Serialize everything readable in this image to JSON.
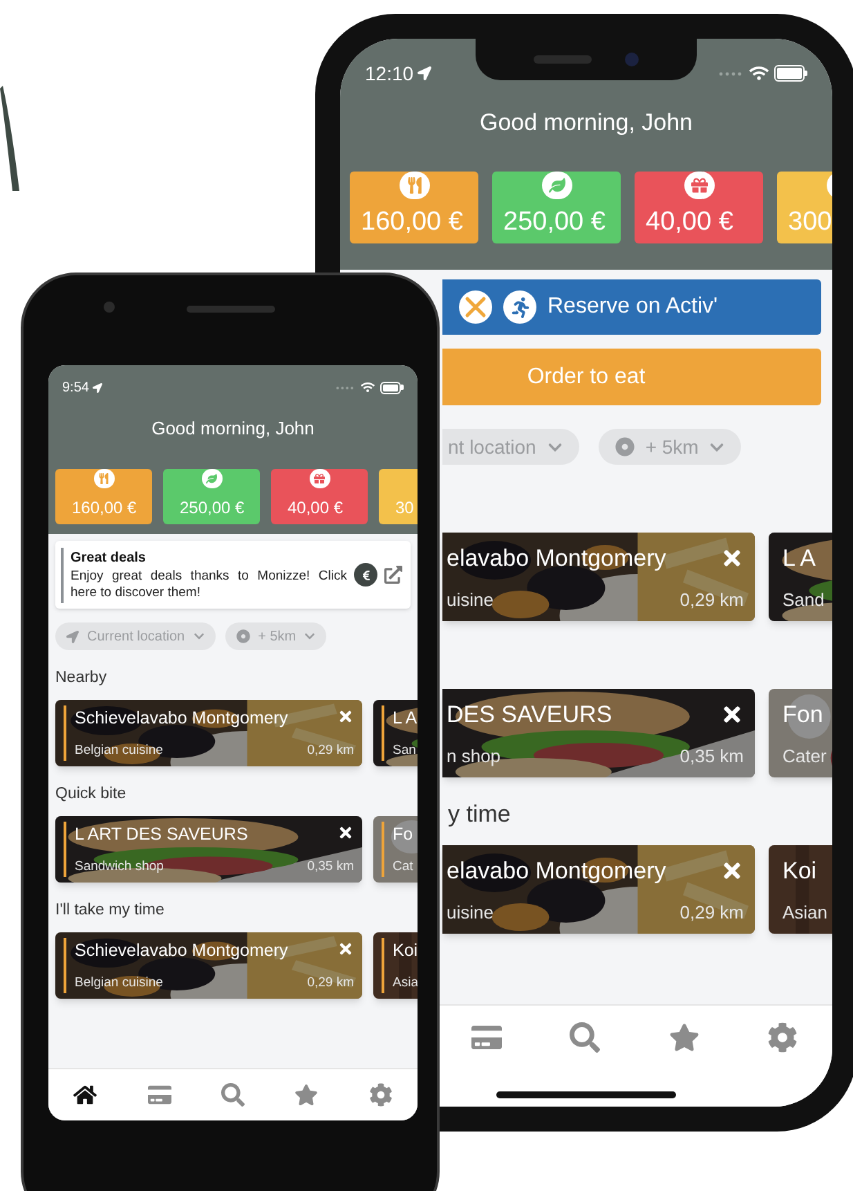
{
  "back_phone": {
    "status_time": "12:10",
    "greeting": "Good morning, John",
    "wallets": [
      {
        "kind": "meal",
        "amount": "160,00 €",
        "color": "#eea43a"
      },
      {
        "kind": "eco",
        "amount": "250,00 €",
        "color": "#5bc96b"
      },
      {
        "kind": "gift",
        "amount": "40,00 €",
        "color": "#e9535a"
      },
      {
        "kind": "sport",
        "amount": "300",
        "color": "#f3c14b"
      }
    ],
    "reserve_button": "Reserve on Activ'",
    "order_button": "Order to eat",
    "filters": [
      {
        "kind": "plain",
        "label": "nt location"
      },
      {
        "kind": "radius",
        "label": "+ 5km"
      }
    ],
    "sections": [
      {
        "cards": [
          {
            "kind": "mussels",
            "name": "elavabo Montgomery",
            "category": "uisine",
            "distance": "0,29 km"
          },
          {
            "kind": "sandwich",
            "name": "L A",
            "category": "Sand"
          }
        ]
      },
      {
        "cards": [
          {
            "kind": "sandwich",
            "name": "DES SAVEURS",
            "category": "n shop",
            "distance": "0,35 km"
          },
          {
            "kind": "catering",
            "name": "Fon",
            "category": "Cater"
          }
        ]
      },
      {
        "title": "y time",
        "cards": [
          {
            "kind": "mussels",
            "name": "elavabo Montgomery",
            "category": "uisine",
            "distance": "0,29 km"
          },
          {
            "kind": "wood",
            "name": "Koi",
            "category": "Asian"
          }
        ]
      }
    ],
    "tabs": [
      {
        "kind": "card",
        "selected": false
      },
      {
        "kind": "search",
        "selected": false
      },
      {
        "kind": "star",
        "selected": false
      },
      {
        "kind": "settings",
        "selected": false
      }
    ]
  },
  "front_phone": {
    "status_time": "9:54",
    "greeting": "Good morning, John",
    "wallets": [
      {
        "kind": "meal",
        "amount": "160,00 €",
        "color": "#eea43a"
      },
      {
        "kind": "eco",
        "amount": "250,00 €",
        "color": "#5bc96b"
      },
      {
        "kind": "gift",
        "amount": "40,00 €",
        "color": "#e9535a"
      },
      {
        "kind": "cut",
        "amount": "30",
        "color": "#f3c14b"
      }
    ],
    "deal": {
      "title": "Great deals",
      "text": "Enjoy great deals thanks to Monizze! Click here to discover them!"
    },
    "filters": [
      {
        "kind": "location",
        "label": "Current location"
      },
      {
        "kind": "radius",
        "label": "+ 5km"
      }
    ],
    "sections": [
      {
        "title": "Nearby",
        "cards": [
          {
            "kind": "mussels",
            "name": "Schievelavabo Montgomery",
            "category": "Belgian cuisine",
            "distance": "0,29 km"
          },
          {
            "kind": "sandwich",
            "name": "L A",
            "category": "San"
          }
        ]
      },
      {
        "title": "Quick bite",
        "cards": [
          {
            "kind": "sandwich",
            "name": "L ART DES SAVEURS",
            "category": "Sandwich shop",
            "distance": "0,35 km"
          },
          {
            "kind": "catering",
            "name": "Fo",
            "category": "Cat"
          }
        ]
      },
      {
        "title": "I'll take my time",
        "cards": [
          {
            "kind": "mussels",
            "name": "Schievelavabo Montgomery",
            "category": "Belgian cuisine",
            "distance": "0,29 km"
          },
          {
            "kind": "wood",
            "name": "Koi",
            "category": "Asia"
          }
        ]
      }
    ],
    "tabs": [
      {
        "kind": "home",
        "selected": true
      },
      {
        "kind": "card",
        "selected": false
      },
      {
        "kind": "search",
        "selected": false
      },
      {
        "kind": "star",
        "selected": false
      },
      {
        "kind": "settings",
        "selected": false
      }
    ]
  }
}
